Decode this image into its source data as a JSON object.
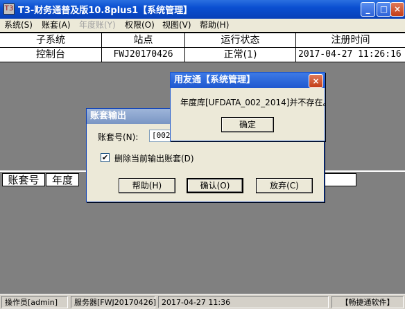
{
  "window": {
    "title": "T3-财务通普及版10.8plus1【系统管理】",
    "app_icon": "T3",
    "buttons": {
      "minimize": "_",
      "maximize": "□",
      "close": "×"
    }
  },
  "menubar": [
    {
      "label": "系统(S)",
      "enabled": true
    },
    {
      "label": "账套(A)",
      "enabled": true
    },
    {
      "label": "年度账(Y)",
      "enabled": false
    },
    {
      "label": "权限(O)",
      "enabled": true
    },
    {
      "label": "视图(V)",
      "enabled": true
    },
    {
      "label": "帮助(H)",
      "enabled": true
    }
  ],
  "subsystems_table": {
    "headers": [
      "子系统",
      "站点",
      "运行状态",
      "注册时间"
    ],
    "rows": [
      [
        "控制台",
        "FWJ20170426",
        "正常(1)",
        "2017-04-27 11:26:16"
      ]
    ]
  },
  "accounts_table": {
    "headers": [
      "账套号",
      "年度"
    ]
  },
  "statusbar": {
    "operator": "操作员[admin]",
    "server": "服务器[FWJ20170426]",
    "datetime": "2017-04-27 11:36",
    "brand": "【畅捷通软件】"
  },
  "backup_dialog": {
    "title": "账套输出",
    "account_label": "账套号(N):",
    "account_value": "[002",
    "checkbox_label": "删除当前输出账套(D)",
    "checkbox_checked": true,
    "help_button": "帮助(H)",
    "ok_button": "确认(O)",
    "cancel_button": "放弃(C)"
  },
  "error_dialog": {
    "title": "用友通【系统管理】",
    "message": "年度库[UFDATA_002_2014]并不存在。",
    "ok_button": "确定",
    "close": "×"
  }
}
